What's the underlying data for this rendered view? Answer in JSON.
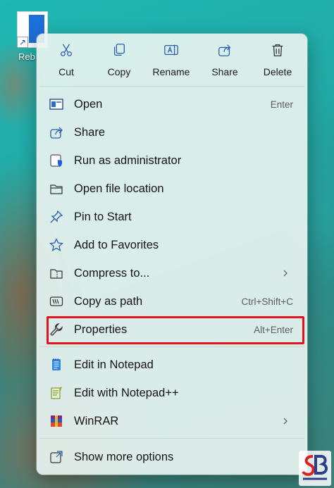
{
  "desktop": {
    "icon_label": "Reb"
  },
  "context_menu": {
    "actions": [
      {
        "label": "Cut",
        "icon": "scissors-icon"
      },
      {
        "label": "Copy",
        "icon": "copy-icon"
      },
      {
        "label": "Rename",
        "icon": "rename-icon"
      },
      {
        "label": "Share",
        "icon": "share-icon"
      },
      {
        "label": "Delete",
        "icon": "trash-icon"
      }
    ],
    "items": [
      {
        "label": "Open",
        "shortcut": "Enter",
        "icon": "open-window-icon"
      },
      {
        "label": "Share",
        "shortcut": "",
        "icon": "share-icon"
      },
      {
        "label": "Run as administrator",
        "shortcut": "",
        "icon": "admin-shield-icon"
      },
      {
        "label": "Open file location",
        "shortcut": "",
        "icon": "folder-icon"
      },
      {
        "label": "Pin to Start",
        "shortcut": "",
        "icon": "pin-icon"
      },
      {
        "label": "Add to Favorites",
        "shortcut": "",
        "icon": "star-icon"
      },
      {
        "label": "Compress to...",
        "shortcut": "",
        "icon": "zip-folder-icon",
        "submenu": true
      },
      {
        "label": "Copy as path",
        "shortcut": "Ctrl+Shift+C",
        "icon": "copy-path-icon"
      },
      {
        "label": "Properties",
        "shortcut": "Alt+Enter",
        "icon": "wrench-icon",
        "highlighted": true
      },
      {
        "label": "Edit in Notepad",
        "shortcut": "",
        "icon": "notepad-icon"
      },
      {
        "label": "Edit with Notepad++",
        "shortcut": "",
        "icon": "notepad-plus-plus-icon"
      },
      {
        "label": "WinRAR",
        "shortcut": "",
        "icon": "winrar-icon",
        "submenu": true
      },
      {
        "label": "Show more options",
        "shortcut": "",
        "icon": "more-options-icon"
      }
    ]
  },
  "colors": {
    "highlight_border": "#e0141c",
    "accent_blue": "#1e6fd9"
  }
}
